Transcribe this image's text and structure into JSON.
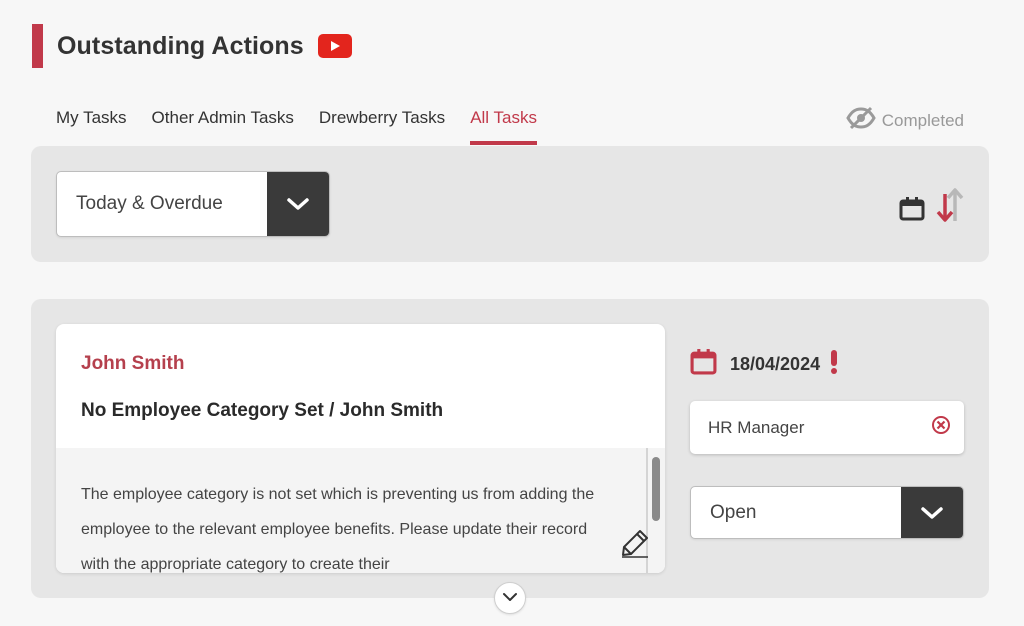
{
  "header": {
    "title": "Outstanding Actions",
    "video_icon": "youtube-play-icon",
    "accent_color": "#c1394a"
  },
  "tabs": [
    {
      "label": "My Tasks",
      "active": false
    },
    {
      "label": "Other Admin Tasks",
      "active": false
    },
    {
      "label": "Drewberry Tasks",
      "active": false
    },
    {
      "label": "All Tasks",
      "active": true
    }
  ],
  "completed_toggle": {
    "label": "Completed",
    "icon": "eye-slash-icon"
  },
  "filter": {
    "selected": "Today & Overdue"
  },
  "sort": {
    "field_icon": "calendar-icon",
    "direction": "descending"
  },
  "task": {
    "person_name": "John Smith",
    "title": "No Employee Category Set / John Smith",
    "description": "The employee category is not set which is preventing us from adding the employee to the relevant employee benefits. Please update their record with the appropriate category to create their",
    "due_date": "18/04/2024",
    "overdue": true,
    "assignee": "HR Manager",
    "status": "Open"
  },
  "colors": {
    "accent": "#c1394a",
    "dark_button": "#3a3a3a",
    "panel_bg": "#e6e6e6"
  }
}
